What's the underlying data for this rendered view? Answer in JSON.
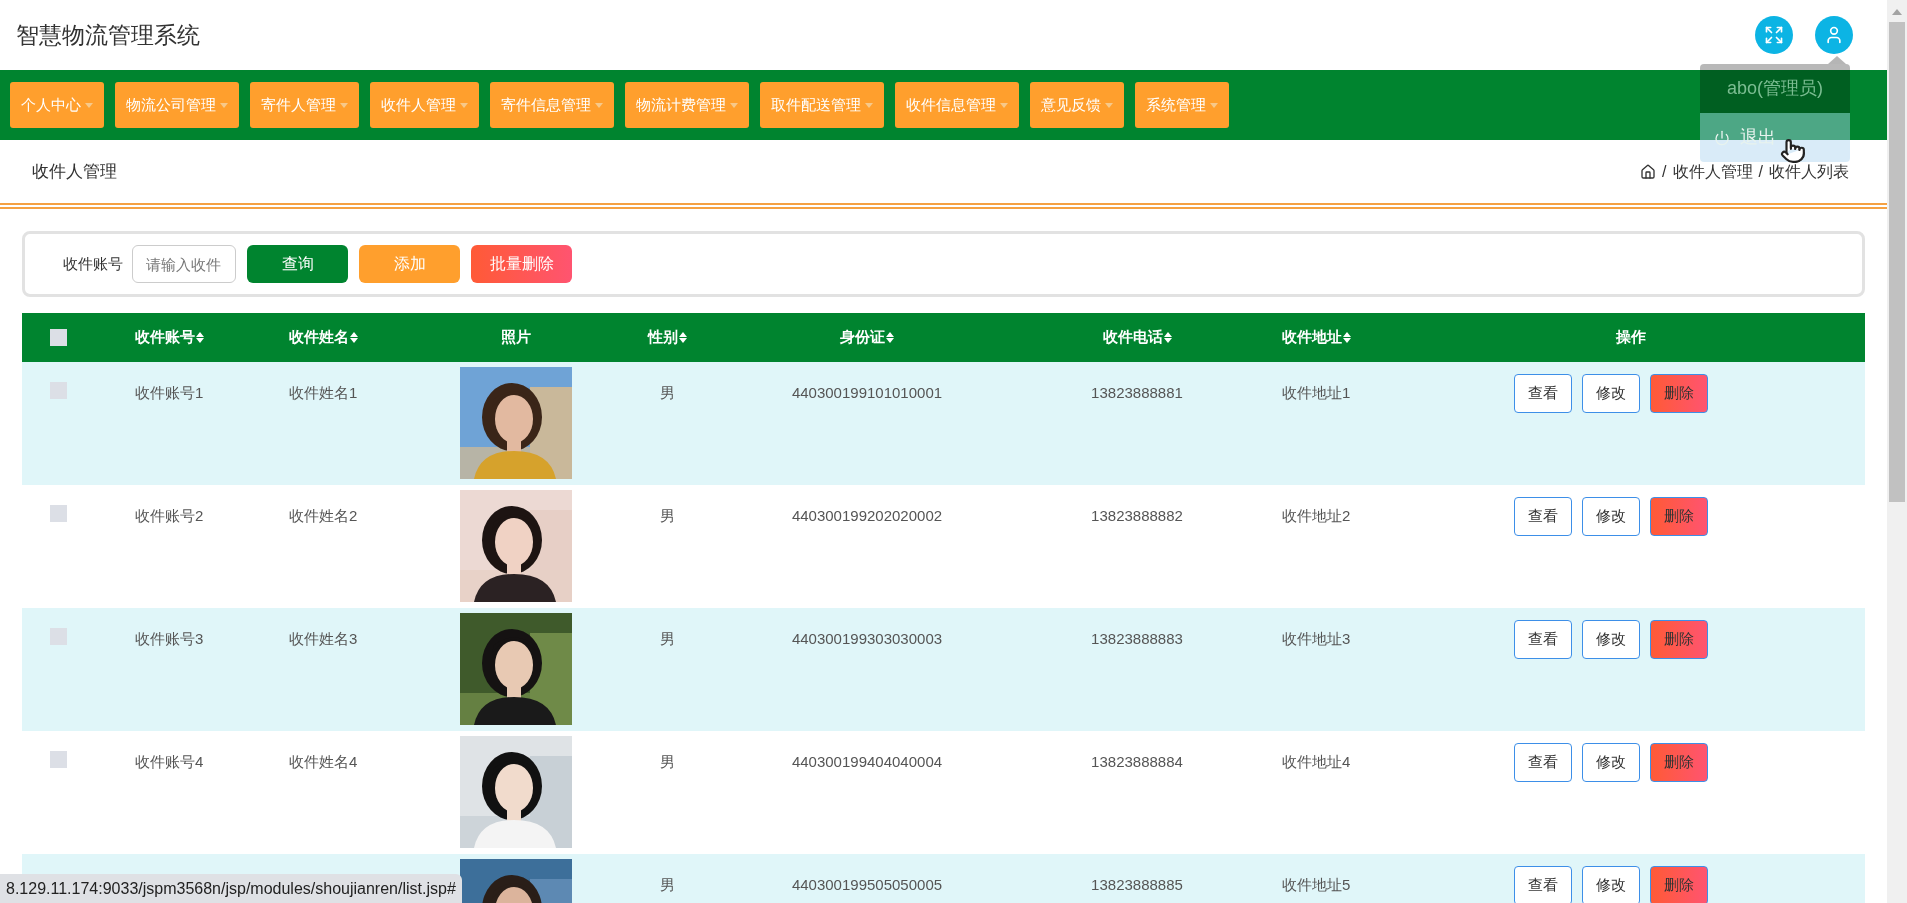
{
  "header": {
    "title": "智慧物流管理系统"
  },
  "user_menu": {
    "username": "abo(管理员)",
    "logout": "退出"
  },
  "nav": [
    {
      "label": "个人中心"
    },
    {
      "label": "物流公司管理"
    },
    {
      "label": "寄件人管理"
    },
    {
      "label": "收件人管理"
    },
    {
      "label": "寄件信息管理"
    },
    {
      "label": "物流计费管理"
    },
    {
      "label": "取件配送管理"
    },
    {
      "label": "收件信息管理"
    },
    {
      "label": "意见反馈"
    },
    {
      "label": "系统管理"
    }
  ],
  "page_title": "收件人管理",
  "breadcrumb": {
    "separator": "/",
    "items": [
      "收件人管理",
      "收件人列表"
    ]
  },
  "search": {
    "label": "收件账号",
    "placeholder": "请输入收件",
    "buttons": [
      {
        "label": "查询",
        "kind": "query"
      },
      {
        "label": "添加",
        "kind": "add"
      },
      {
        "label": "批量删除",
        "kind": "delete"
      }
    ]
  },
  "table": {
    "select_all": {
      "checked": false
    },
    "columns": [
      {
        "label": "收件账号",
        "sortable": true
      },
      {
        "label": "收件姓名",
        "sortable": true
      },
      {
        "label": "照片",
        "sortable": false
      },
      {
        "label": "性别",
        "sortable": true
      },
      {
        "label": "身份证",
        "sortable": true
      },
      {
        "label": "收件电话",
        "sortable": true
      },
      {
        "label": "收件地址",
        "sortable": true
      },
      {
        "label": "操作",
        "sortable": false
      }
    ],
    "rows": [
      {
        "checked": false,
        "account": "收件账号1",
        "name": "收件姓名1",
        "gender": "男",
        "id_card": "440300199101010001",
        "phone": "13823888881",
        "address": "收件地址1",
        "actions": [
          {
            "label": "查看",
            "kind": "view"
          },
          {
            "label": "修改",
            "kind": "edit"
          },
          {
            "label": "删除",
            "kind": "delete"
          }
        ]
      },
      {
        "checked": false,
        "account": "收件账号2",
        "name": "收件姓名2",
        "gender": "男",
        "id_card": "440300199202020002",
        "phone": "13823888882",
        "address": "收件地址2",
        "actions": [
          {
            "label": "查看",
            "kind": "view"
          },
          {
            "label": "修改",
            "kind": "edit"
          },
          {
            "label": "删除",
            "kind": "delete"
          }
        ]
      },
      {
        "checked": false,
        "account": "收件账号3",
        "name": "收件姓名3",
        "gender": "男",
        "id_card": "440300199303030003",
        "phone": "13823888883",
        "address": "收件地址3",
        "actions": [
          {
            "label": "查看",
            "kind": "view"
          },
          {
            "label": "修改",
            "kind": "edit"
          },
          {
            "label": "删除",
            "kind": "delete"
          }
        ]
      },
      {
        "checked": false,
        "account": "收件账号4",
        "name": "收件姓名4",
        "gender": "男",
        "id_card": "440300199404040004",
        "phone": "13823888884",
        "address": "收件地址4",
        "actions": [
          {
            "label": "查看",
            "kind": "view"
          },
          {
            "label": "修改",
            "kind": "edit"
          },
          {
            "label": "删除",
            "kind": "delete"
          }
        ]
      },
      {
        "gender": "男",
        "id_card": "440300199505050005",
        "phone": "13823888885",
        "address": "收件地址5",
        "actions": [
          {
            "label": "查看",
            "kind": "view"
          },
          {
            "label": "修改",
            "kind": "edit"
          },
          {
            "label": "删除",
            "kind": "delete"
          }
        ]
      }
    ]
  },
  "status_bar": {
    "url": "8.129.11.174:9033/jspm3568n/jsp/modules/shoujianren/list.jsp#"
  }
}
